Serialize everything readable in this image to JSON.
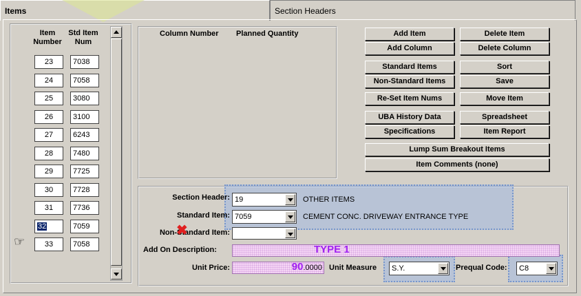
{
  "tabs": {
    "items": "Items",
    "section_headers": "Section Headers"
  },
  "item_list": {
    "header_item": "Item\nNumber",
    "header_std": "Std Item\nNum",
    "rows": [
      {
        "item": "23",
        "std": "7038"
      },
      {
        "item": "24",
        "std": "7058"
      },
      {
        "item": "25",
        "std": "3080"
      },
      {
        "item": "26",
        "std": "3100"
      },
      {
        "item": "27",
        "std": "6243"
      },
      {
        "item": "28",
        "std": "7480"
      },
      {
        "item": "29",
        "std": "7725"
      },
      {
        "item": "30",
        "std": "7728"
      },
      {
        "item": "31",
        "std": "7736"
      },
      {
        "item": "32",
        "std": "7059"
      },
      {
        "item": "33",
        "std": "7058"
      }
    ],
    "selected_item": "32"
  },
  "columns": {
    "column_number": "Column Number",
    "planned_quantity": "Planned Quantity"
  },
  "buttons": {
    "add_item": "Add Item",
    "delete_item": "Delete Item",
    "add_column": "Add Column",
    "delete_column": "Delete Column",
    "standard_items": "Standard Items",
    "sort": "Sort",
    "non_standard_items": "Non-Standard Items",
    "save": "Save",
    "reset_item_nums": "Re-Set Item Nums",
    "move_item": "Move Item",
    "uba_history": "UBA History Data",
    "spreadsheet": "Spreadsheet",
    "specifications": "Specifications",
    "item_report": "Item Report",
    "lump_sum": "Lump Sum Breakout Items",
    "item_comments": "Item Comments (none)"
  },
  "details": {
    "section_header_label": "Section Header:",
    "section_header_value": "19",
    "section_header_desc": "OTHER ITEMS",
    "standard_item_label": "Standard Item:",
    "standard_item_value": "7059",
    "standard_item_desc": "CEMENT CONC. DRIVEWAY ENTRANCE TYPE",
    "non_standard_label": "Non-Standard Item:",
    "non_standard_value": "",
    "add_on_label": "Add On Description:",
    "add_on_value": "TYPE 1",
    "unit_price_label": "Unit Price:",
    "unit_price_int": "90",
    "unit_price_dec": ".0000",
    "unit_measure_label": "Unit Measure",
    "unit_measure_value": "S.Y.",
    "prequal_label": "Prequal Code:",
    "prequal_value": "C8"
  },
  "colors": {
    "face": "#d4d0c8",
    "highlight_blue": "#96b4e6",
    "purple_text": "#a020f0"
  }
}
